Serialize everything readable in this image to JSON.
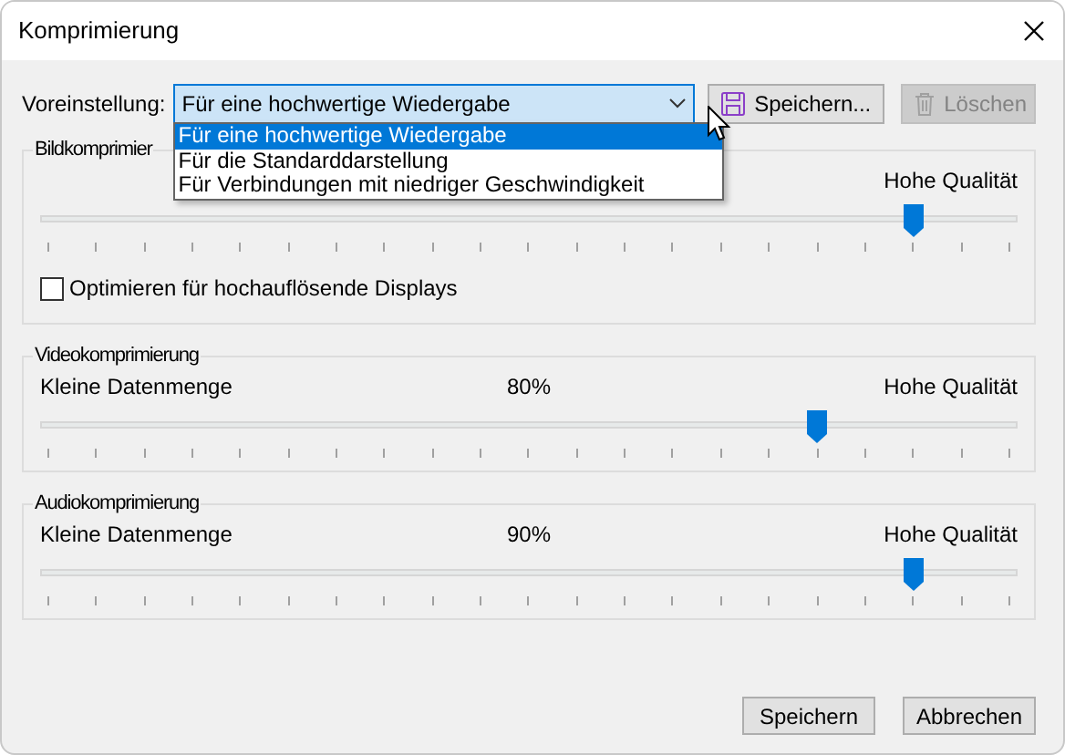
{
  "window": {
    "title": "Komprimierung"
  },
  "preset": {
    "label": "Voreinstellung:",
    "value": "Für eine hochwertige Wiedergabe",
    "expanded": true,
    "options": [
      {
        "label": "Für eine hochwertige Wiedergabe",
        "selected": true
      },
      {
        "label": "Für die Standarddarstellung",
        "selected": false
      },
      {
        "label": "Für Verbindungen mit niedriger Geschwindigkeit",
        "selected": false
      }
    ]
  },
  "preset_buttons": [
    {
      "label": "Speichern...",
      "kind": "save",
      "disabled": false
    },
    {
      "label": "Löschen",
      "kind": "delete",
      "disabled": true
    }
  ],
  "groups": [
    {
      "title": "Bildkomprimier",
      "max_label": "Hohe Qualität",
      "level": 0.9,
      "checkbox": {
        "label": "Optimieren für hochauflösende Displays",
        "checked": false
      }
    },
    {
      "title": "Videokomprimierung",
      "min_label": "Kleine Datenmenge",
      "reading": "80%",
      "max_label": "Hohe Qualität",
      "level": 0.8
    },
    {
      "title": "Audiokomprimierung",
      "min_label": "Kleine Datenmenge",
      "reading": "90%",
      "max_label": "Hohe Qualität",
      "level": 0.9
    }
  ],
  "buttons": [
    {
      "label": "Speichern"
    },
    {
      "label": "Abbrechen"
    }
  ]
}
